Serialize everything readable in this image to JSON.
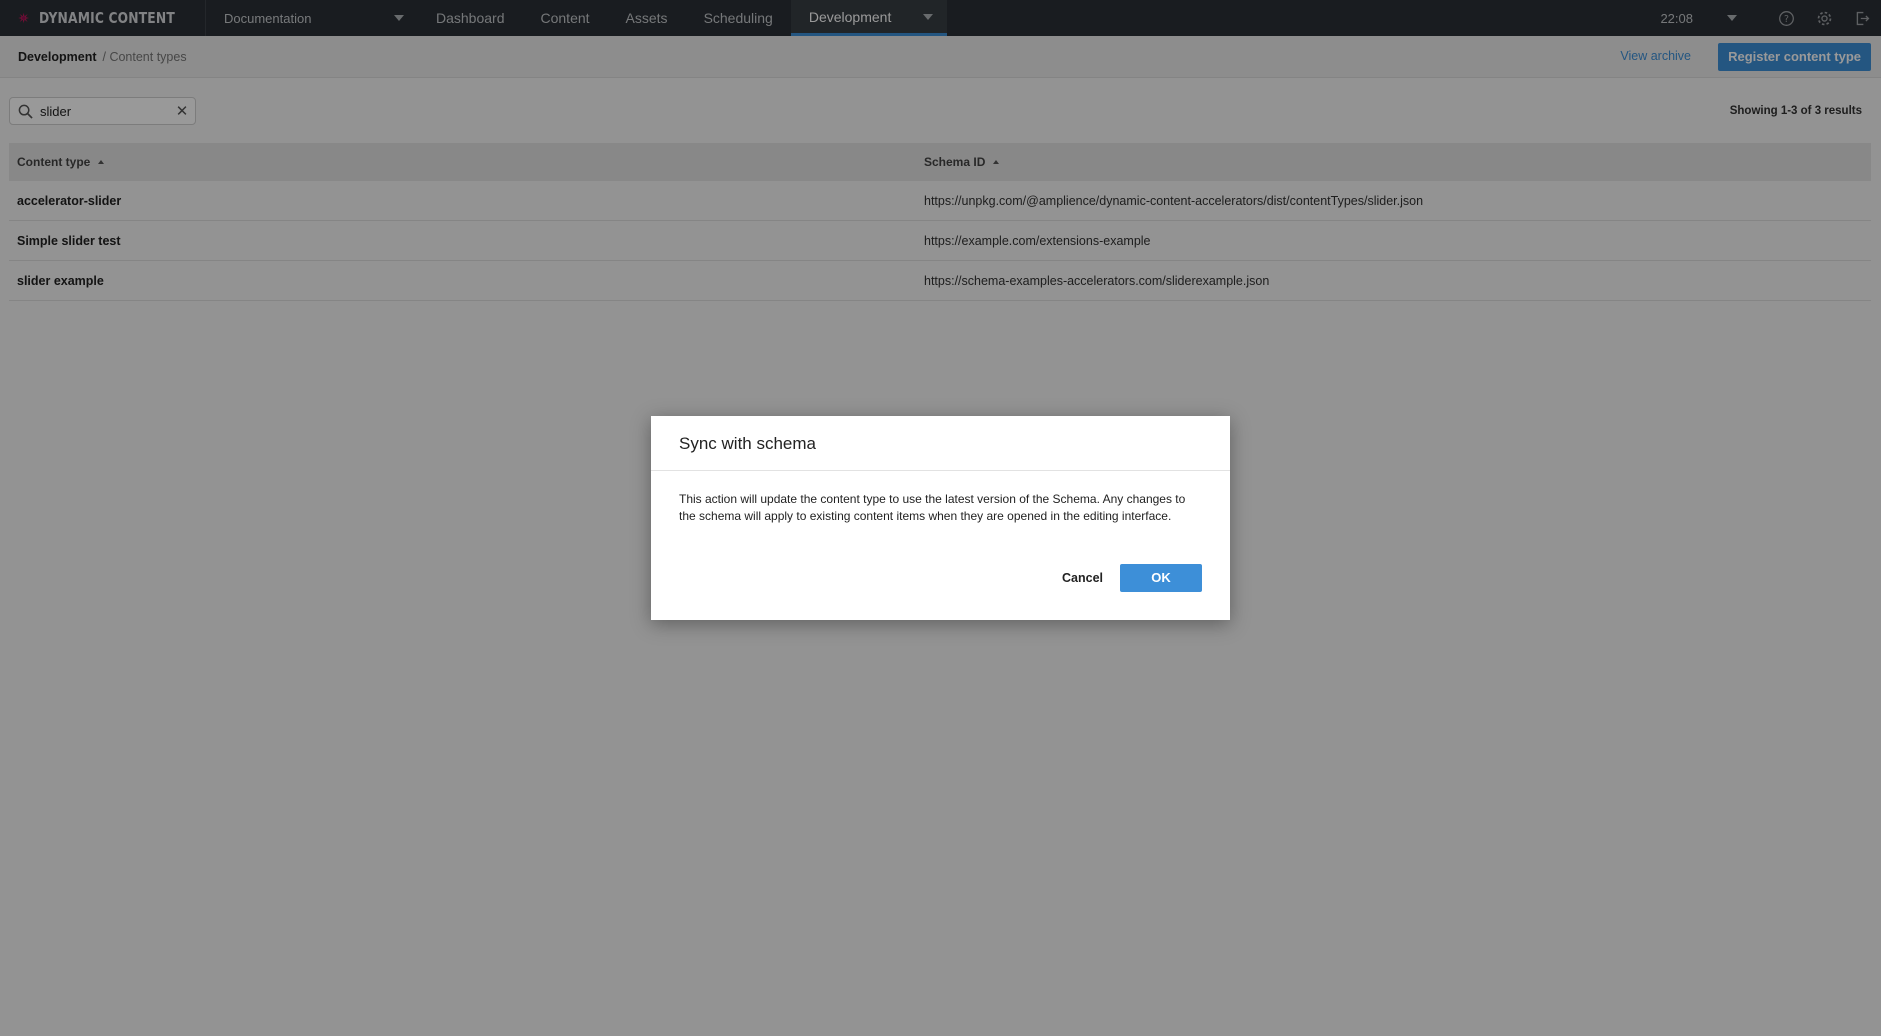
{
  "app": {
    "name": "DYNAMIC CONTENT",
    "logo_icon": "starburst-logo"
  },
  "hub": {
    "label": "Documentation",
    "icon": "chevron-down-icon"
  },
  "nav": {
    "tabs": [
      {
        "label": "Dashboard",
        "active": false
      },
      {
        "label": "Content",
        "active": false
      },
      {
        "label": "Assets",
        "active": false
      },
      {
        "label": "Scheduling",
        "active": false
      },
      {
        "label": "Development",
        "active": true
      }
    ]
  },
  "topright": {
    "time": "22:08",
    "icons": [
      "help-icon",
      "gear-icon",
      "logout-icon"
    ]
  },
  "breadcrumb": {
    "root": "Development",
    "current": "/ Content types"
  },
  "actions": {
    "view_archive": "View archive",
    "register": "Register content type"
  },
  "search": {
    "value": "slider"
  },
  "results": {
    "summary": "Showing 1-3 of 3 results"
  },
  "table": {
    "columns": [
      "Content type",
      "Schema ID"
    ],
    "rows": [
      {
        "name": "accelerator-slider",
        "schema": "https://unpkg.com/@amplience/dynamic-content-accelerators/dist/contentTypes/slider.json"
      },
      {
        "name": "Simple slider test",
        "schema": "https://example.com/extensions-example"
      },
      {
        "name": "slider example",
        "schema": "https://schema-examples-accelerators.com/sliderexample.json"
      }
    ]
  },
  "dialog": {
    "title": "Sync with schema",
    "body_line1": "This action will update the content type to use the latest version of the Schema. Any changes to",
    "body_line2": "the schema will apply to existing content items when they are opened in the editing interface.",
    "cancel": "Cancel",
    "ok": "OK"
  },
  "colors": {
    "accent": "#3d8fd8",
    "topbar": "#2b3036",
    "logo": "#c2185b"
  }
}
